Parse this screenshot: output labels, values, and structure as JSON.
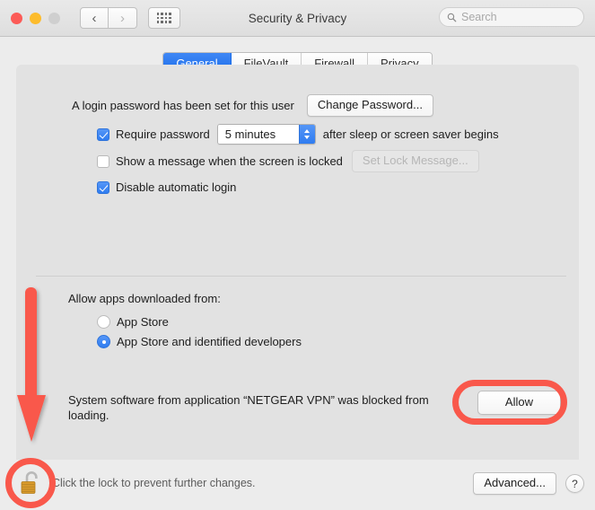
{
  "window": {
    "title": "Security & Privacy",
    "traffic_lights": [
      "close",
      "minimize",
      "zoom"
    ],
    "nav": {
      "back": "‹",
      "forward": "›"
    },
    "grid_button": "show-all-icon"
  },
  "search": {
    "placeholder": "Search",
    "value": "",
    "icon": "search-icon"
  },
  "tabs": [
    {
      "label": "General",
      "active": true
    },
    {
      "label": "FileVault",
      "active": false
    },
    {
      "label": "Firewall",
      "active": false
    },
    {
      "label": "Privacy",
      "active": false
    }
  ],
  "general": {
    "password_status": "A login password has been set for this user",
    "change_password_label": "Change Password...",
    "require_password": {
      "label": "Require password",
      "checked": true,
      "interval_value": "5 minutes",
      "suffix": "after sleep or screen saver begins"
    },
    "show_message": {
      "label": "Show a message when the screen is locked",
      "checked": false,
      "button_label": "Set Lock Message...",
      "button_disabled": true
    },
    "disable_auto_login": {
      "label": "Disable automatic login",
      "checked": true
    }
  },
  "allow_apps": {
    "title": "Allow apps downloaded from:",
    "options": [
      {
        "label": "App Store",
        "selected": false
      },
      {
        "label": "App Store and identified developers",
        "selected": true
      }
    ]
  },
  "blocked": {
    "message": "System software from application “NETGEAR VPN” was blocked from loading.",
    "allow_label": "Allow"
  },
  "bottom": {
    "lock_icon": "unlocked-padlock-icon",
    "lock_hint": "Click the lock to prevent further changes.",
    "advanced_label": "Advanced...",
    "help_label": "?"
  },
  "annotations": {
    "color": "#f9584b",
    "arrow": "down-arrow-annotation",
    "ring_allow": "highlight-ring-allow",
    "ring_lock": "highlight-ring-lock"
  }
}
